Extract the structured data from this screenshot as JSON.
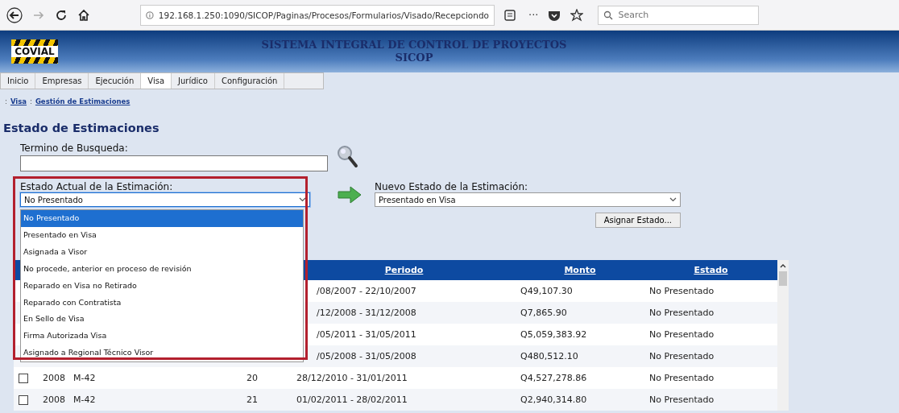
{
  "browser": {
    "url": "192.168.1.250:1090/SICOP/Paginas/Procesos/Formularios/Visado/Recepciondo",
    "more": "···",
    "search_placeholder": "Search"
  },
  "header": {
    "logo": "COVIAL",
    "title": "SISTEMA INTEGRAL DE CONTROL DE PROYECTOS",
    "subtitle": "SICOP"
  },
  "menu": [
    {
      "label": "Inicio",
      "selected": false
    },
    {
      "label": "Empresas",
      "selected": false
    },
    {
      "label": "Ejecución",
      "selected": false
    },
    {
      "label": "Visa",
      "selected": true
    },
    {
      "label": "Jurídico",
      "selected": false
    },
    {
      "label": "Configuración",
      "selected": false
    }
  ],
  "breadcrumb": [
    {
      "separator": ":",
      "label": "Visa"
    },
    {
      "separator": ":",
      "label": "Gestión de Estimaciones"
    }
  ],
  "heading": "Estado de Estimaciones",
  "search": {
    "label": "Termino de Busqueda:"
  },
  "current_state": {
    "label": "Estado Actual de la Estimación:",
    "value": "No Presentado",
    "expanded": true,
    "options": [
      {
        "label": "No Presentado",
        "selected": true
      },
      {
        "label": "Presentado en Visa",
        "selected": false
      },
      {
        "label": "Asignada a Visor",
        "selected": false
      },
      {
        "label": "No procede, anterior en proceso de revisión",
        "selected": false
      },
      {
        "label": "Reparado en Visa no Retirado",
        "selected": false
      },
      {
        "label": "Reparado con Contratista",
        "selected": false
      },
      {
        "label": "En Sello de Visa",
        "selected": false
      },
      {
        "label": "Firma Autorizada Visa",
        "selected": false
      },
      {
        "label": "Asignado a Regional Técnico Visor",
        "selected": false
      }
    ]
  },
  "new_state": {
    "label": "Nuevo Estado de la Estimación:",
    "value": "Presentado en Visa"
  },
  "assign_button": "Asignar Estado...",
  "table": {
    "columns": [
      "Periodo",
      "Monto",
      "Estado"
    ],
    "rows": [
      {
        "period": "/08/2007 - 22/10/2007",
        "amount": "Q49,107.30",
        "status": "No Presentado"
      },
      {
        "period": "/12/2008 - 31/12/2008",
        "amount": "Q7,865.90",
        "status": "No Presentado"
      },
      {
        "period": "/05/2011 - 31/05/2011",
        "amount": "Q5,059,383.92",
        "status": "No Presentado"
      },
      {
        "period": "/05/2008 - 31/05/2008",
        "amount": "Q480,512.10",
        "status": "No Presentado"
      },
      {
        "checked": false,
        "year": "2008",
        "code": "M-42",
        "number": "20",
        "period": "28/12/2010 - 31/01/2011",
        "amount": "Q4,527,278.86",
        "status": "No Presentado"
      },
      {
        "checked": false,
        "year": "2008",
        "code": "M-42",
        "number": "21",
        "period": "01/02/2011 - 28/02/2011",
        "amount": "Q2,940,314.80",
        "status": "No Presentado"
      }
    ]
  }
}
